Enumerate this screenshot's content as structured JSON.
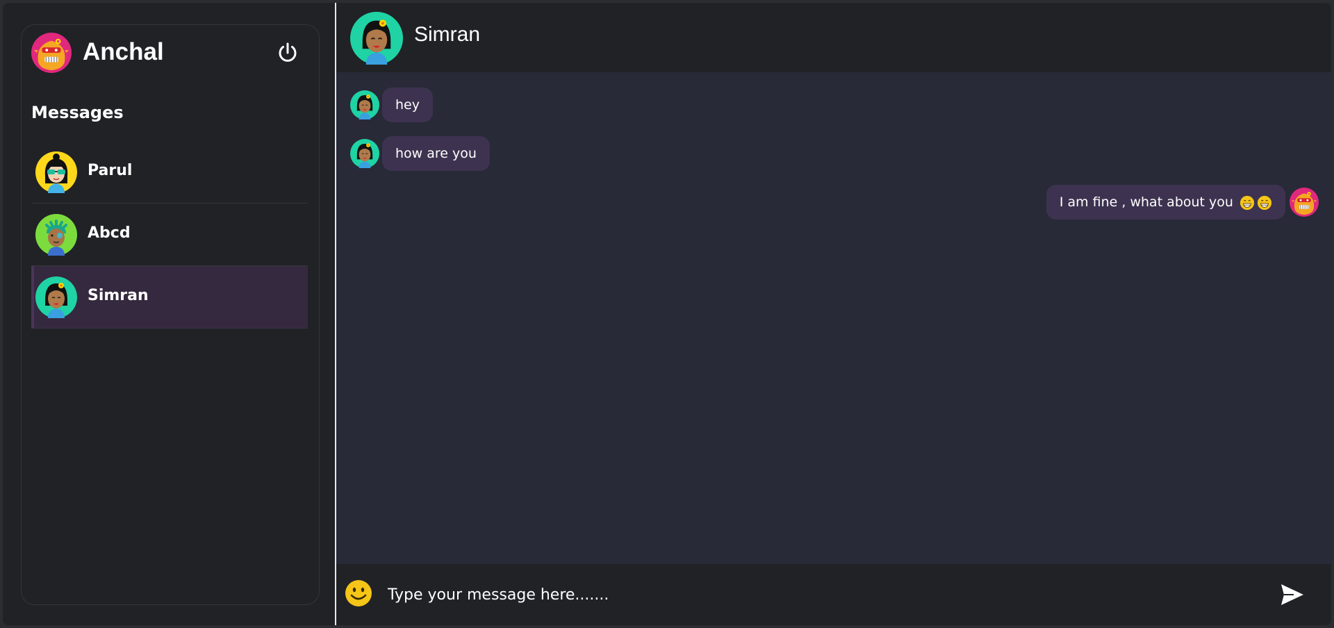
{
  "current_user": {
    "name": "Anchal"
  },
  "sidebar": {
    "heading": "Messages",
    "contacts": [
      {
        "name": "Parul",
        "active": false
      },
      {
        "name": "Abcd",
        "active": false
      },
      {
        "name": "Simran",
        "active": true
      }
    ]
  },
  "chat": {
    "contact_name": "Simran",
    "messages": [
      {
        "direction": "incoming",
        "text": "hey"
      },
      {
        "direction": "incoming",
        "text": "how are you"
      },
      {
        "direction": "outgoing",
        "text": "I am fine , what about you",
        "emoji": "grinning-face-icon x2"
      }
    ]
  },
  "composer": {
    "placeholder": "Type your message here.......",
    "value": ""
  },
  "colors": {
    "app_bg": "#202226",
    "chat_bg": "#282a37",
    "bubble": "#3d3350",
    "active_contact": "#35293f",
    "smile_yellow": "#f5c518"
  }
}
